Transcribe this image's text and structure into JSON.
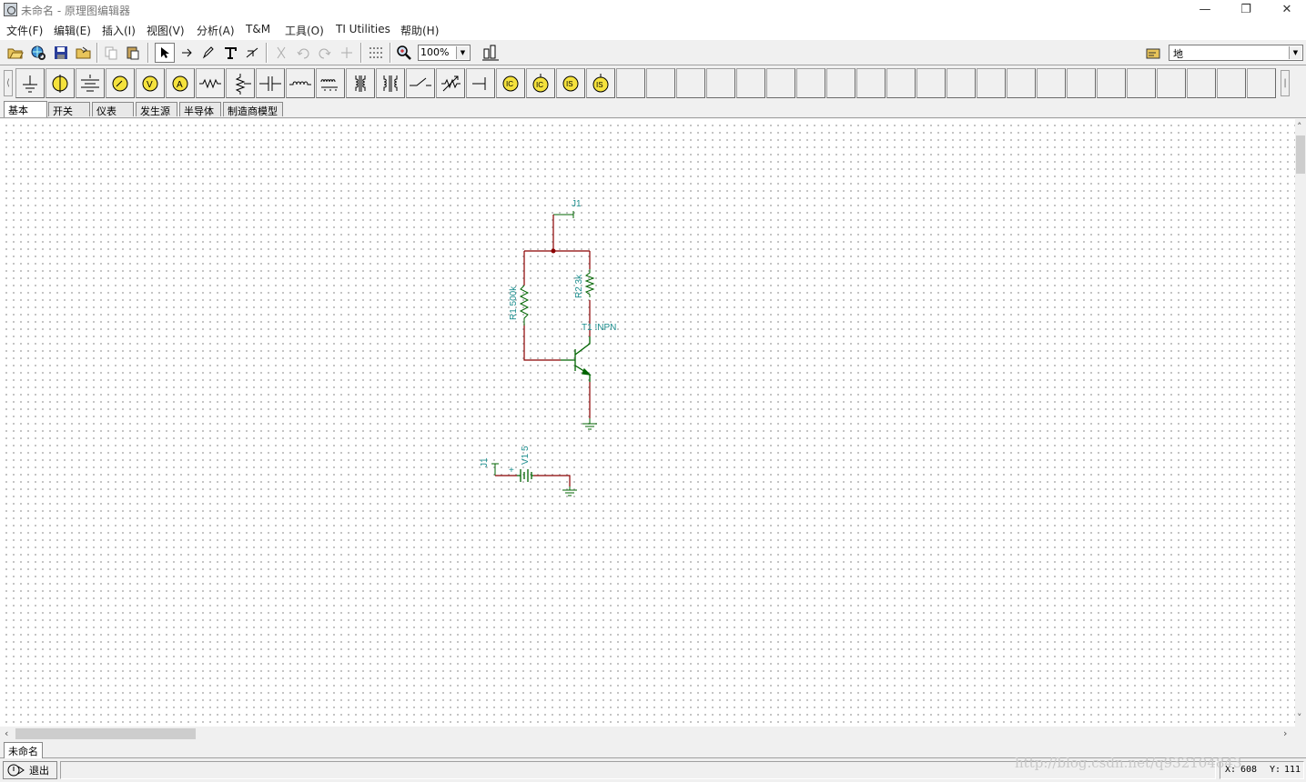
{
  "window": {
    "title": "未命名 - 原理图编辑器",
    "controls": {
      "minimize": "—",
      "restore": "❐",
      "close": "✕"
    }
  },
  "menu": {
    "items": [
      "文件(F)",
      "编辑(E)",
      "插入(I)",
      "视图(V)",
      "分析(A)",
      "T&M",
      "工具(O)",
      "TI Utilities",
      "帮助(H)"
    ]
  },
  "toolbar": {
    "zoom": "100%",
    "layer": "地"
  },
  "component_tabs": {
    "items": [
      "基本",
      "开关",
      "仪表",
      "发生源",
      "半导体",
      "制造商模型"
    ],
    "active": "基本"
  },
  "component_palette": {
    "icons": [
      "ground-icon",
      "lamp-icon",
      "battery-icon",
      "voltmeter-icon",
      "voltmeter-v-icon",
      "ammeter-icon",
      "resistor-icon",
      "potentiometer-icon",
      "capacitor-icon",
      "inductor-icon",
      "transformer-icon",
      "coupled-inductor-icon",
      "transformer-core-icon",
      "switch-icon",
      "varistor-icon",
      "terminal-icon",
      "ic-source-icon",
      "ic-source2-icon",
      "is-source-icon",
      "is-source2-icon"
    ]
  },
  "schematic": {
    "labels": {
      "jumper_top": "J1",
      "r1": "R1 500k",
      "r2": "R2 3k",
      "transistor": "T1 !NPN",
      "jumper_bottom": "J1",
      "battery": "V1 5",
      "plus": "+"
    },
    "colors": {
      "wire": "#8b0000",
      "component": "#006400",
      "label": "#1a8c8c"
    }
  },
  "document_tab": "未命名",
  "status": {
    "exit": "退出",
    "x_label": "X:",
    "x_value": "608",
    "y_label": "Y:",
    "y_value": "111"
  },
  "watermark": "http://blog.csdn.net/q932104843"
}
